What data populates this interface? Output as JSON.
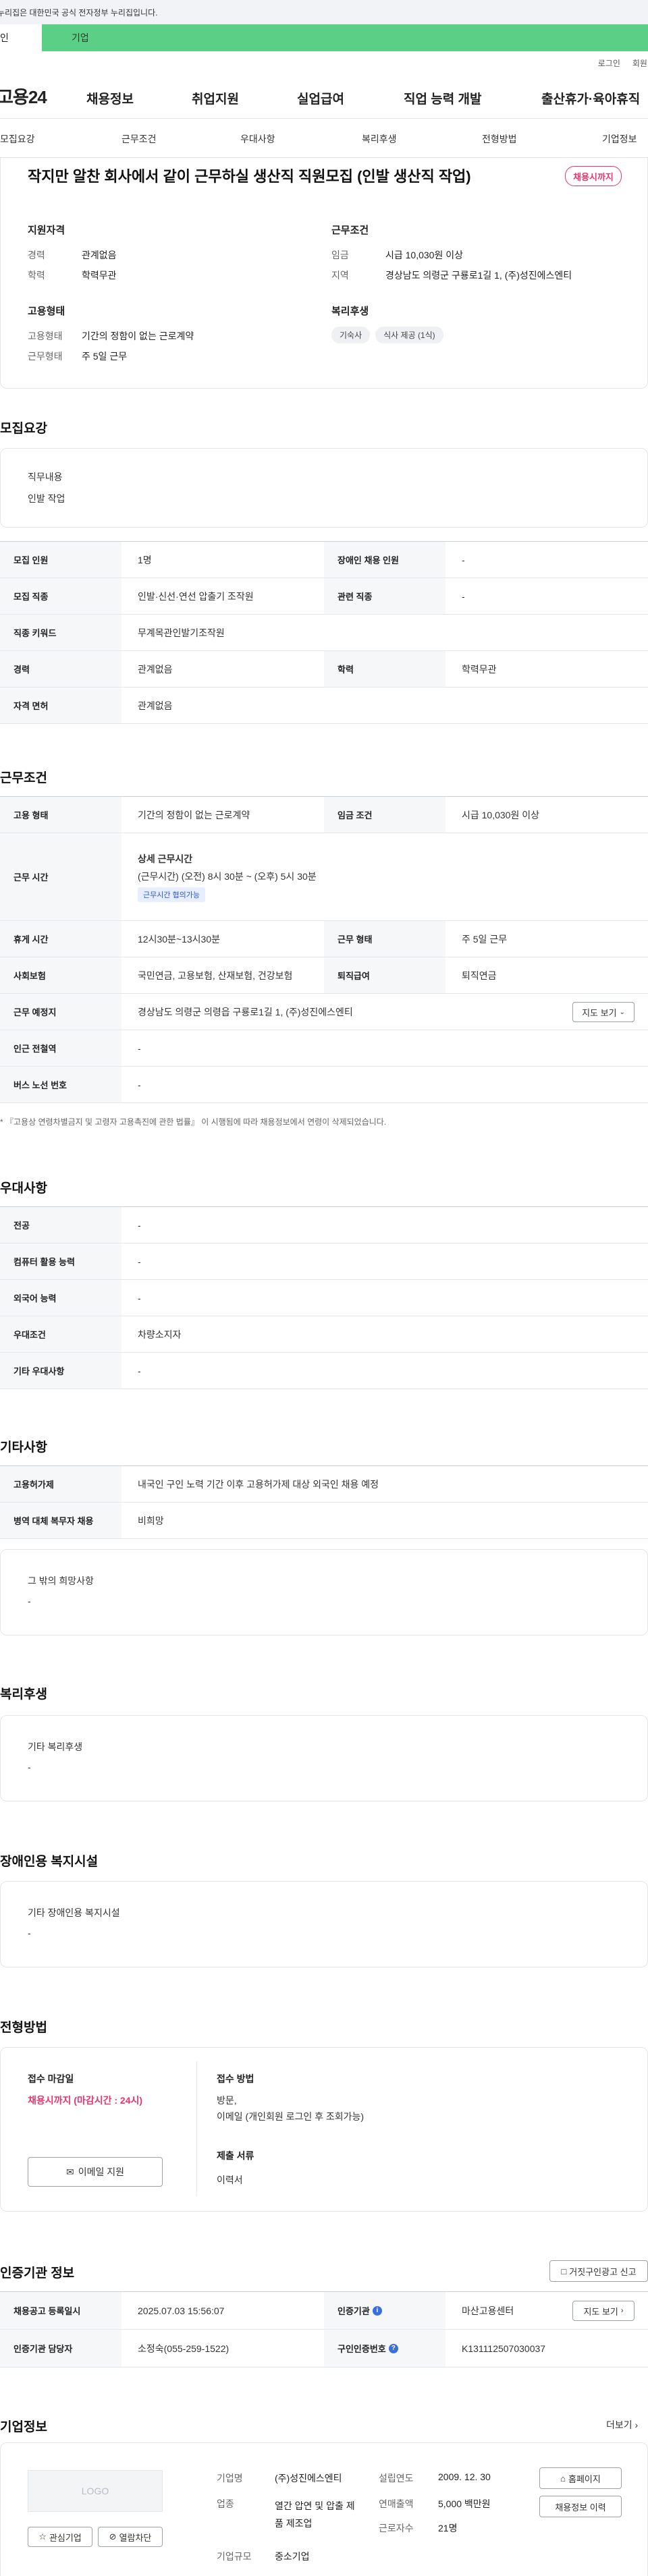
{
  "banner": {
    "text": "누리집은 대한민국 공식 전자정부 누리집입니다."
  },
  "site_tabs": {
    "tab_a": "인",
    "tab_b": "기업"
  },
  "util": {
    "login": "로그인",
    "join": "회원가"
  },
  "gnb": {
    "logo": "고용24",
    "items": [
      "채용정보",
      "취업지원",
      "실업급여",
      "직업 능력 개발",
      "출산휴가·육아휴직"
    ]
  },
  "subnav": [
    "모집요강",
    "근무조건",
    "우대사항",
    "복리후생",
    "전형방법",
    "기업정보"
  ],
  "summary": {
    "title": "작지만 알찬 회사에서 같이 근무하실 생산직 직원모집 (인발 생산직 작업)",
    "status": "채용시까지",
    "qual_title": "지원자격",
    "qual": [
      {
        "label": "경력",
        "value": "관계없음"
      },
      {
        "label": "학력",
        "value": "학력무관"
      }
    ],
    "cond_title": "근무조건",
    "cond": [
      {
        "label": "임금",
        "value": "시급 10,030원 이상"
      },
      {
        "label": "지역",
        "value": "경상남도 의령군 구룡로1길 1, (주)성진에스엔티"
      }
    ],
    "emp_title": "고용형태",
    "emp": [
      {
        "label": "고용형태",
        "value": "기간의 정함이 없는 근로계약"
      },
      {
        "label": "근무형태",
        "value": "주 5일 근무"
      }
    ],
    "welfare_title": "복리후생",
    "welfare_chips": [
      "기숙사",
      "식사 제공 (1식)"
    ]
  },
  "recruit": {
    "section_title": "모집요강",
    "duty_label": "직무내용",
    "duty_value": "인발 작업",
    "rows": [
      {
        "l1": "모집 인원",
        "v1": "1명",
        "l2": "장애인 채용 인원",
        "v2": "-"
      },
      {
        "l1": "모집 직종",
        "v1": "인발·신선·연선 압출기 조작원",
        "l2": "관련 직종",
        "v2": "-"
      },
      {
        "l1": "직종 키워드",
        "v1": "무계목관인발기조작원"
      },
      {
        "l1": "경력",
        "v1": "관계없음",
        "l2": "학력",
        "v2": "학력무관"
      },
      {
        "l1": "자격 면허",
        "v1": "관계없음"
      }
    ]
  },
  "work": {
    "section_title": "근무조건",
    "r1": {
      "l1": "고용 형태",
      "v1": "기간의 정함이 없는 근로계약",
      "l2": "임금 조건",
      "v2": "시급 10,030원 이상"
    },
    "hours_label": "근무 시간",
    "hours_title": "상세 근무시간",
    "hours_value": "(근무시간) (오전) 8시 30분 ~ (오후) 5시 30분",
    "hours_chip": "근무시간 협의가능",
    "r3": {
      "l1": "휴게 시간",
      "v1": "12시30분~13시30분",
      "l2": "근무 형태",
      "v2": "주 5일 근무"
    },
    "r4": {
      "l1": "사회보험",
      "v1": "국민연금, 고용보험, 산재보험, 건강보험",
      "l2": "퇴직급여",
      "v2": "퇴직연금"
    },
    "r5": {
      "l1": "근무 예정지",
      "v1": "경상남도 의령군 의령읍 구룡로1길 1, (주)성진에스엔티",
      "btn": "지도 보기"
    },
    "r6": {
      "l1": "인근 전철역",
      "v1": "-"
    },
    "r7": {
      "l1": "버스 노선 번호",
      "v1": "-"
    },
    "note": "* 『고용상 연령차별금지 및 고령자 고용촉진에 관한 법률』 이 시행됨에 따라 채용정보에서 연령이 삭제되었습니다."
  },
  "pref": {
    "section_title": "우대사항",
    "rows": [
      {
        "l": "전공",
        "v": "-"
      },
      {
        "l": "컴퓨터 활용 능력",
        "v": "-"
      },
      {
        "l": "외국어 능력",
        "v": "-"
      },
      {
        "l": "우대조건",
        "v": "차량소지자"
      },
      {
        "l": "기타 우대사항",
        "v": "-"
      }
    ]
  },
  "etc": {
    "section_title": "기타사항",
    "rows": [
      {
        "l": "고용허가제",
        "v": "내국인 구인 노력 기간 이후 고용허가제 대상 외국인 채용 예정"
      },
      {
        "l": "병역 대체 복무자 채용",
        "v": "비희망"
      }
    ],
    "other_title": "그 밖의 희망사항",
    "other_value": "-"
  },
  "welfare": {
    "section_title": "복리후생",
    "box_title": "기타 복리후생",
    "box_value": "-"
  },
  "disab": {
    "section_title": "장애인용 복지시설",
    "box_title": "기타 장애인용 복지시설",
    "box_value": "-"
  },
  "process": {
    "section_title": "전형방법",
    "deadline_label": "접수 마감일",
    "deadline_value": "채용시까지 (마감시간 : 24시)",
    "email_btn": "이메일 지원",
    "method_label": "접수 방법",
    "method_value1": "방문,",
    "method_value2": "이메일 (개인회원 로그인 후 조회가능)",
    "docs_label": "제출 서류",
    "docs_value": "이력서"
  },
  "cert": {
    "section_title": "인증기관 정보",
    "report_btn": "거짓구인광고 신고",
    "r1": {
      "l1": "채용공고 등록일시",
      "v1": "2025.07.03 15:56:07",
      "l2": "인증기관",
      "v2": "마산고용센터",
      "btn": "지도 보기"
    },
    "r2": {
      "l1": "인증기관 담당자",
      "v1": "소정숙(055-259-1522)",
      "l2": "구인인증번호",
      "v2": "K131112507030037"
    }
  },
  "company": {
    "section_title": "기업정보",
    "more": "더보기",
    "logo_text": "LOGO",
    "fav_btn": "관심기업",
    "block_btn": "열람차단",
    "name_label": "기업명",
    "name": "(주)성진에스엔티",
    "biz_label": "업종",
    "biz": "열간 압연 및 압출 제품 제조업",
    "scale_label": "기업규모",
    "scale": "중소기업",
    "est_label": "설립연도",
    "est": "2009. 12. 30",
    "sales_label": "연매출액",
    "sales": "5,000 백만원",
    "emp_label": "근로자수",
    "emp": "21명",
    "home_btn": "홈페이지",
    "jobs_btn": "채용정보 이력"
  }
}
